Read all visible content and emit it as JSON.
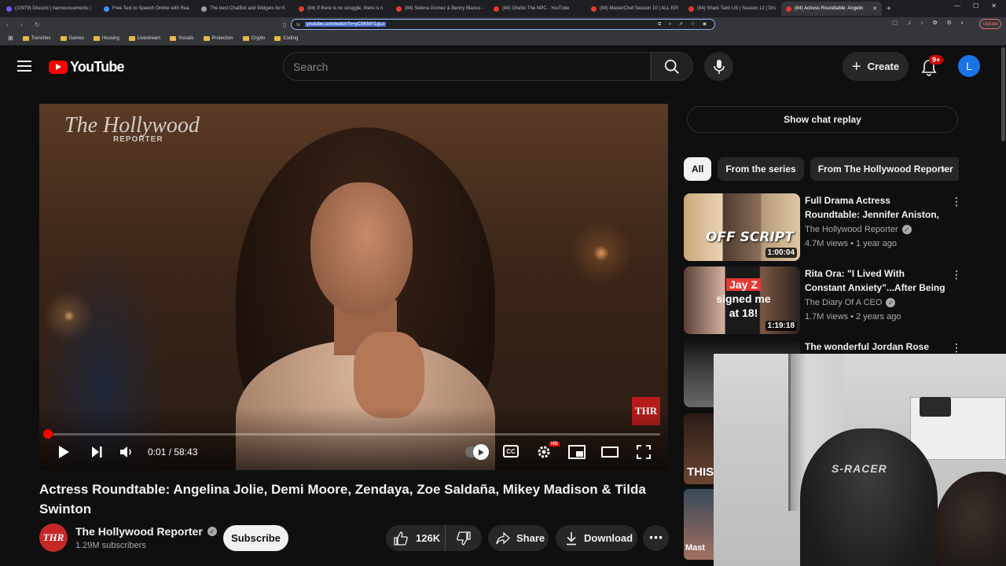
{
  "browser": {
    "tabs": [
      {
        "label": "(10979) Discord | #announcements |",
        "favicon": "purple"
      },
      {
        "label": "Free Text to Speech Online with Rea",
        "favicon": "blue"
      },
      {
        "label": "The best ChatBot and Widgets for K",
        "favicon": "gray"
      },
      {
        "label": "(84) If there is no struggle, there is n",
        "favicon": "red"
      },
      {
        "label": "(84) Selena Gomez & Benny Blanco -",
        "favicon": "red"
      },
      {
        "label": "(84) Ghetto The NPC - YouTube",
        "favicon": "red"
      },
      {
        "label": "(84) MasterChef Season 10 | ALL EPI",
        "favicon": "red"
      },
      {
        "label": "(84) Shark Tank US | Season 12 | Drs",
        "favicon": "red"
      },
      {
        "label": "(84) Actress Roundtable: Angelin",
        "favicon": "red",
        "active": true
      }
    ],
    "url": "youtube.com/watch?v=yCSKMY1gLo",
    "update_label": "Update",
    "bookmarks": [
      "Trenches",
      "Games",
      "Housing",
      "Livestream",
      "Socials",
      "Protection",
      "Crypto",
      "Coding"
    ]
  },
  "header": {
    "logo_text": "YouTube",
    "search_placeholder": "Search",
    "create_label": "Create",
    "notification_badge": "9+",
    "avatar_letter": "L"
  },
  "player": {
    "watermark": "The Hollywood",
    "watermark_sub": "REPORTER",
    "corner_logo": "THR",
    "time_current": "0:01",
    "time_total": "58:43",
    "time_display": "0:01 / 58:43",
    "progress_fraction": 0.0003,
    "cc_label": "CC",
    "hd_label": "HD"
  },
  "video": {
    "title": "Actress Roundtable: Angelina Jolie, Demi Moore, Zendaya, Zoe Saldaña, Mikey Madison & Tilda Swinton",
    "channel_name": "The Hollywood Reporter",
    "channel_avatar": "THR",
    "subscribers": "1.29M subscribers",
    "subscribe_label": "Subscribe",
    "likes": "126K",
    "share_label": "Share",
    "download_label": "Download"
  },
  "sidebar": {
    "chat_replay_label": "Show chat replay",
    "chips": [
      "All",
      "From the series",
      "From The Hollywood Reporter"
    ],
    "recommendations": [
      {
        "title": "Full Drama Actress Roundtable: Jennifer Aniston, Sofia Vergar...",
        "channel": "The Hollywood Reporter",
        "verified": true,
        "meta": "4.7M views • 1 year ago",
        "duration": "1:00:04",
        "thumb_text": "OFF SCRIPT"
      },
      {
        "title": "Rita Ora: \"I Lived With Constant Anxiety\"...After Being Signed B...",
        "channel": "The Diary Of A CEO",
        "verified": true,
        "meta": "1.7M views • 2 years ago",
        "duration": "1:19:18",
        "thumb_text_1": "Jay Z",
        "thumb_text_2": "signed me at 18!"
      },
      {
        "title": "The wonderful Jordan Rose",
        "channel": "",
        "meta": "",
        "duration": ""
      }
    ],
    "partial_thumb_text_1": "THIS",
    "partial_thumb_text_2": "Mast"
  },
  "webcam": {
    "chair_brand": "S-RACER"
  },
  "colors": {
    "background": "#0f0f0f",
    "brand_red": "#ff0000",
    "progress_red": "#ff0000",
    "text_primary": "#f1f1f1",
    "text_secondary": "#aaaaaa",
    "pill_bg": "#272727"
  }
}
